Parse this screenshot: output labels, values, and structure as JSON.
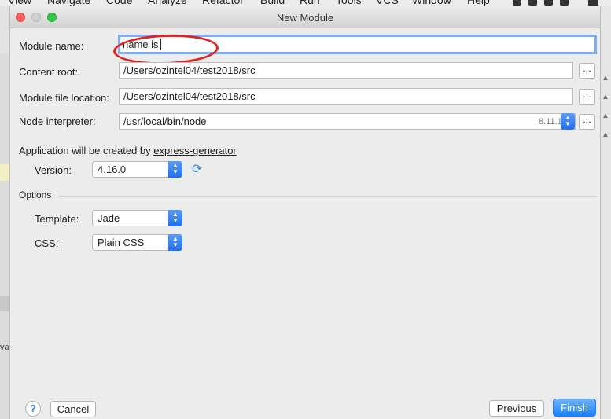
{
  "menubar": {
    "items": [
      "View",
      "Navigate",
      "Code",
      "Analyze",
      "Refactor",
      "Build",
      "Run",
      "Tools",
      "VCS",
      "Window",
      "Help"
    ]
  },
  "background": {
    "left_fragment": "va"
  },
  "dialog": {
    "title": "New Module",
    "module_name": {
      "label": "Module name:",
      "value": "name is"
    },
    "content_root": {
      "label": "Content root:",
      "value": "/Users/ozintel04/test2018/src",
      "browse_label": "..."
    },
    "module_file_location": {
      "label": "Module file location:",
      "value": "/Users/ozintel04/test2018/src",
      "browse_label": "..."
    },
    "node_interpreter": {
      "label": "Node interpreter:",
      "value": "/usr/local/bin/node",
      "version": "8.11.1",
      "browse_label": "..."
    },
    "generator": {
      "text": "Application will be created by ",
      "link": "express-generator"
    },
    "version": {
      "label": "Version:",
      "value": "4.16.0"
    },
    "options": {
      "heading": "Options",
      "template": {
        "label": "Template:",
        "value": "Jade"
      },
      "css": {
        "label": "CSS:",
        "value": "Plain CSS"
      }
    },
    "footer": {
      "help_label": "?",
      "cancel_label": "Cancel",
      "previous_label": "Previous",
      "finish_label": "Finish"
    }
  },
  "colors": {
    "accent": "#1a82fb",
    "focus_ring": "#7eadf1",
    "annotation": "#e0231f"
  }
}
